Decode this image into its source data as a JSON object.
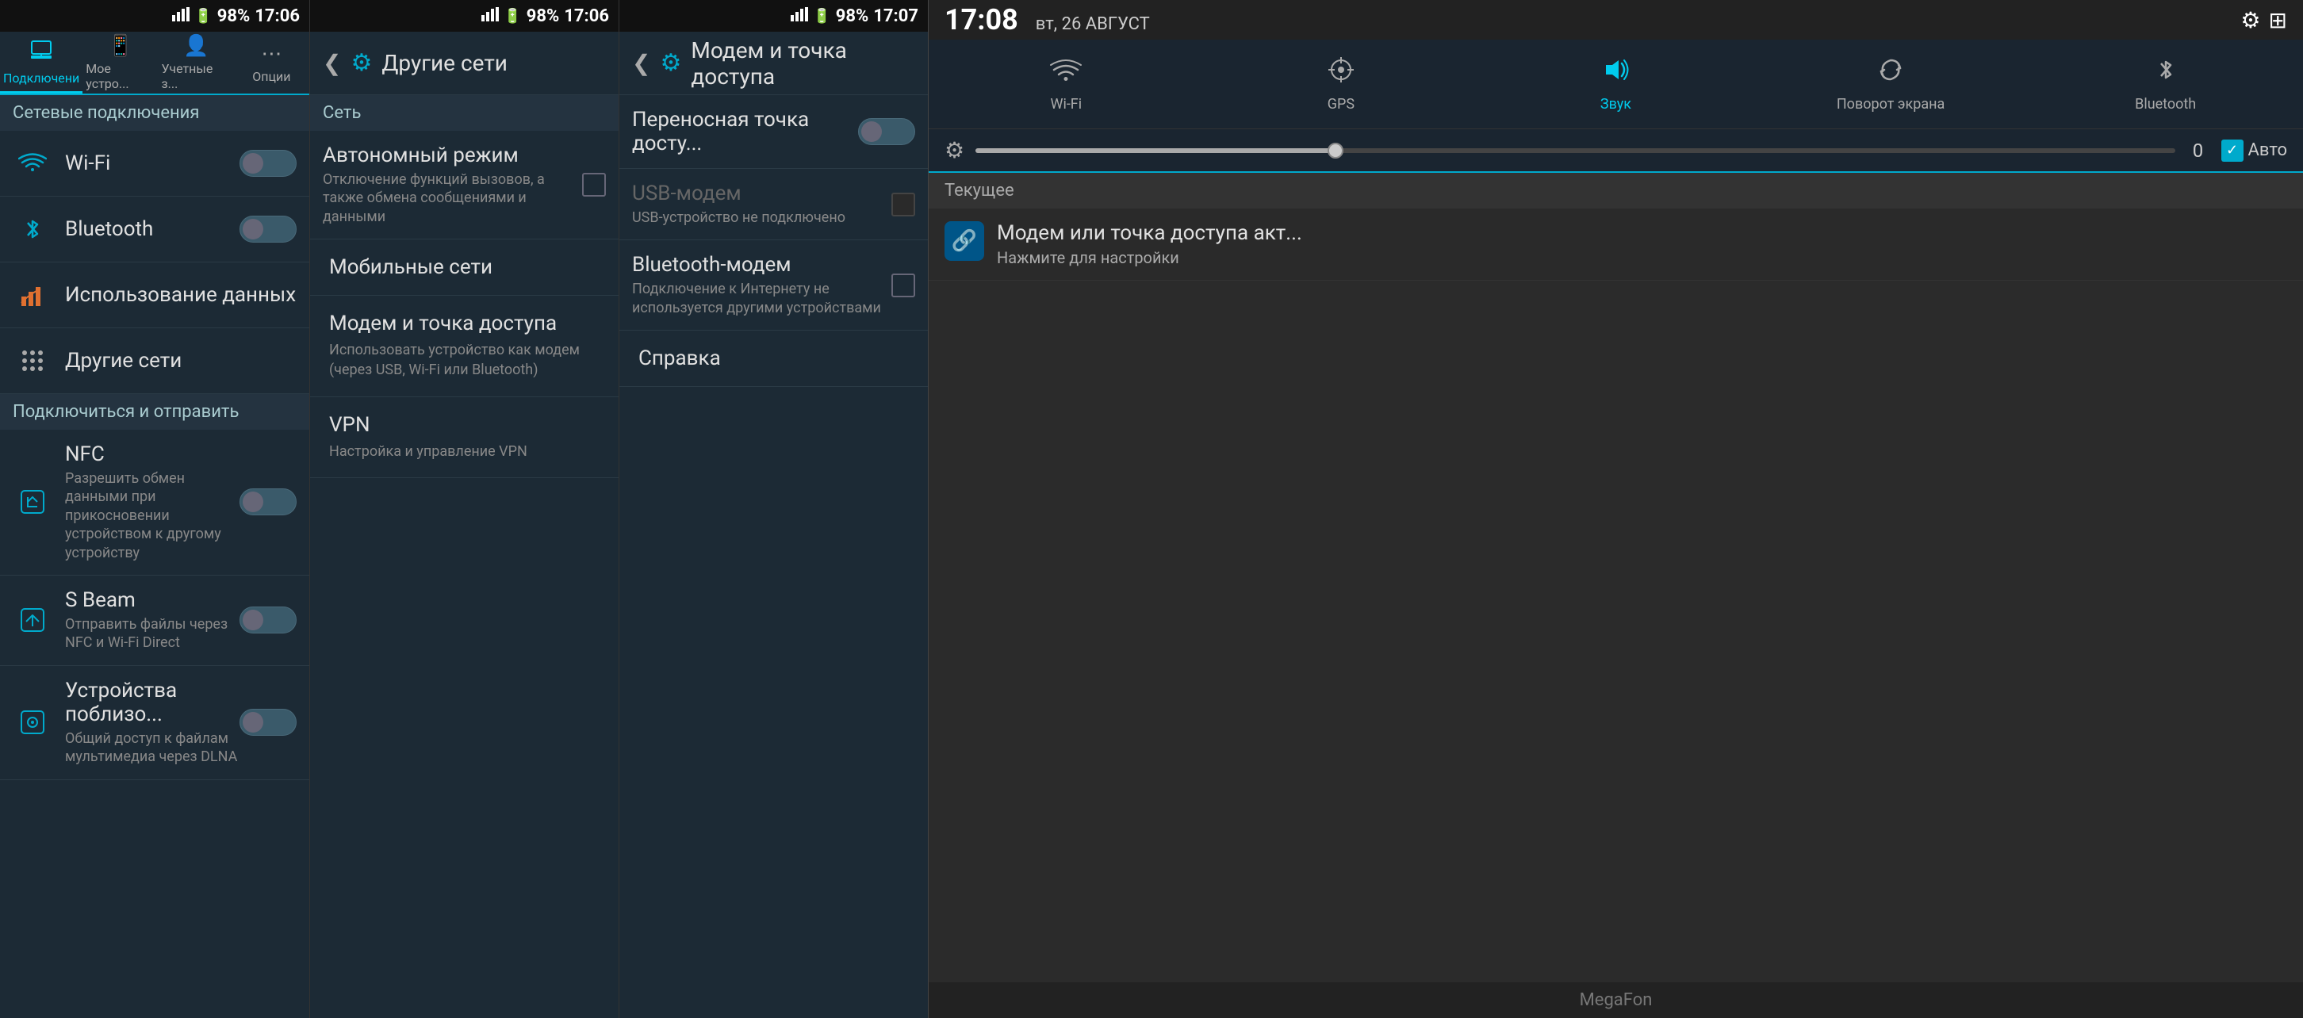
{
  "panel1": {
    "statusBar": {
      "signal": "▲▲▲",
      "battery": "98%",
      "time": "17:06"
    },
    "tabs": [
      {
        "id": "connections",
        "label": "Подключени",
        "icon": "🔗",
        "active": true
      },
      {
        "id": "mydevice",
        "label": "Мое устро...",
        "icon": "📱",
        "active": false
      },
      {
        "id": "accounts",
        "label": "Учетные з...",
        "icon": "👤",
        "active": false
      },
      {
        "id": "options",
        "label": "Опции",
        "icon": "⋯",
        "active": false
      }
    ],
    "sectionHeader": "Сетевые подключения",
    "items": [
      {
        "id": "wifi",
        "title": "Wi-Fi",
        "subtitle": "",
        "hasToggle": true,
        "toggleOn": false,
        "icon": "wifi"
      },
      {
        "id": "bluetooth",
        "title": "Bluetooth",
        "subtitle": "",
        "hasToggle": true,
        "toggleOn": false,
        "icon": "bluetooth"
      },
      {
        "id": "dataUsage",
        "title": "Использование данных",
        "subtitle": "",
        "hasToggle": false,
        "icon": "chart"
      },
      {
        "id": "otherNetworks",
        "title": "Другие сети",
        "subtitle": "",
        "hasToggle": false,
        "icon": "grid"
      }
    ],
    "section2Header": "Подключиться и отправить",
    "items2": [
      {
        "id": "nfc",
        "title": "NFC",
        "subtitle": "Разрешить обмен данными при прикосновении устройством к другому устройству",
        "hasToggle": true,
        "toggleOn": false,
        "icon": "nfc"
      },
      {
        "id": "sbeam",
        "title": "S Beam",
        "subtitle": "Отправить файлы через NFC и Wi-Fi Direct",
        "hasToggle": true,
        "toggleOn": false,
        "icon": "sbeam"
      },
      {
        "id": "nearby",
        "title": "Устройства поблизо...",
        "subtitle": "Общий доступ к файлам мультимедиа через DLNA",
        "hasToggle": true,
        "toggleOn": false,
        "icon": "nearby"
      }
    ]
  },
  "panel2": {
    "statusBar": {
      "signal": "▲▲▲",
      "battery": "98%",
      "time": "17:06"
    },
    "header": {
      "title": "Другие сети",
      "icon": "⚙"
    },
    "networkSection": "Сеть",
    "items": [
      {
        "id": "airplane",
        "title": "Автономный режим",
        "subtitle": "Отключение функций вызовов, а также обмена сообщениями и данными",
        "hasCheckbox": true
      },
      {
        "id": "mobile",
        "title": "Мобильные сети",
        "subtitle": ""
      },
      {
        "id": "tethering",
        "title": "Модем и точка доступа",
        "subtitle": "Использовать устройство как модем (через USB, Wi-Fi или Bluetooth)"
      },
      {
        "id": "vpn",
        "title": "VPN",
        "subtitle": "Настройка и управление VPN"
      }
    ]
  },
  "panel3": {
    "statusBar": {
      "signal": "▲▲▲",
      "battery": "98%",
      "time": "17:07"
    },
    "header": {
      "title": "Модем и точка доступа",
      "icon": "⚙"
    },
    "items": [
      {
        "id": "hotspot",
        "title": "Переносная точка досту...",
        "subtitle": "",
        "hasToggle": true,
        "toggleOn": false
      },
      {
        "id": "usbModem",
        "title": "USB-модем",
        "subtitle": "USB-устройство не подключено",
        "hasCheckbox": true,
        "disabled": true
      },
      {
        "id": "bluetoothModem",
        "title": "Bluetooth-модем",
        "subtitle": "Подключение к Интернету не используется другими устройствами",
        "hasCheckbox": true
      },
      {
        "id": "help",
        "title": "Справка",
        "subtitle": ""
      }
    ]
  },
  "panel4": {
    "statusBar": {
      "time": "17:08",
      "date": "вт, 26 АВГУСТ"
    },
    "quickSettings": [
      {
        "id": "wifi",
        "icon": "wifi",
        "label": "Wi-Fi",
        "active": false
      },
      {
        "id": "gps",
        "icon": "gps",
        "label": "GPS",
        "active": false
      },
      {
        "id": "sound",
        "icon": "sound",
        "label": "Звук",
        "active": true
      },
      {
        "id": "rotate",
        "icon": "rotate",
        "label": "Поворот экрана",
        "active": false
      },
      {
        "id": "bluetooth",
        "icon": "bluetooth",
        "label": "Bluetooth",
        "active": false
      }
    ],
    "brightness": {
      "value": "0",
      "autoLabel": "Авто"
    },
    "currentSection": "Текущее",
    "notifications": [
      {
        "id": "tethering",
        "title": "Модем или точка доступа акт...",
        "subtitle": "Нажмите для настройки",
        "icon": "🔗"
      }
    ],
    "carrier": "MegaFon"
  }
}
